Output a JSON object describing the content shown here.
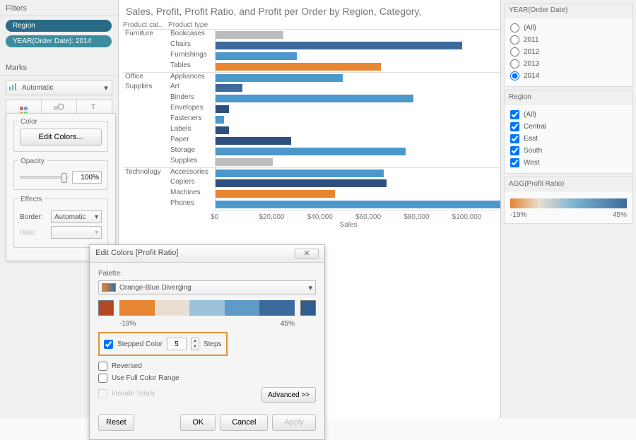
{
  "filters": {
    "title": "Filters",
    "pills": [
      "Region",
      "YEAR(Order Date): 2014"
    ]
  },
  "marks": {
    "title": "Marks",
    "automatic": "Automatic",
    "cells": {
      "color": "Color",
      "size": "Size",
      "label": "Label"
    }
  },
  "color_popup": {
    "color_legend": "Color",
    "edit_colors": "Edit Colors...",
    "opacity_legend": "Opacity",
    "opacity_value": "100%",
    "effects_legend": "Effects",
    "border_label": "Border:",
    "border_value": "Automatic",
    "halo_label": "Halo:"
  },
  "chart": {
    "title": "Sales, Profit, Profit Ratio, and Profit per Order by Region, Category,",
    "hdr_cat": "Product cat..",
    "hdr_type": "Product type",
    "x_axis_title": "Sales",
    "x_ticks": [
      "$0",
      "$20,000",
      "$40,000",
      "$60,000",
      "$80,000",
      "$100,000"
    ]
  },
  "chart_data": {
    "type": "bar",
    "x_axis": "Sales",
    "x_range": [
      0,
      105000
    ],
    "color_encoding": "AGG(Profit Ratio)",
    "color_range_labels": [
      "-19%",
      "45%"
    ],
    "groups": [
      {
        "category": "Furniture",
        "rows": [
          {
            "type": "Bookcases",
            "value": 25000,
            "color": "#bdbdbd"
          },
          {
            "type": "Chairs",
            "value": 91000,
            "color": "#3c6a9c"
          },
          {
            "type": "Furnishings",
            "value": 30000,
            "color": "#4b99cb"
          },
          {
            "type": "Tables",
            "value": 61000,
            "color": "#e78532"
          }
        ]
      },
      {
        "category": "Office Supplies",
        "short": "Office",
        "short2": "Supplies",
        "rows": [
          {
            "type": "Appliances",
            "value": 47000,
            "color": "#4b99cb"
          },
          {
            "type": "Art",
            "value": 10000,
            "color": "#3c6a9c"
          },
          {
            "type": "Binders",
            "value": 73000,
            "color": "#4b99cb"
          },
          {
            "type": "Envelopes",
            "value": 5000,
            "color": "#2f4f7f"
          },
          {
            "type": "Fasteners",
            "value": 3000,
            "color": "#4b99cb"
          },
          {
            "type": "Labels",
            "value": 5000,
            "color": "#2f4f7f"
          },
          {
            "type": "Paper",
            "value": 28000,
            "color": "#2f4f7f"
          },
          {
            "type": "Storage",
            "value": 70000,
            "color": "#4b99cb"
          },
          {
            "type": "Supplies",
            "value": 21000,
            "color": "#bdbdbd"
          }
        ]
      },
      {
        "category": "Technology",
        "rows": [
          {
            "type": "Accessories",
            "value": 62000,
            "color": "#4b99cb"
          },
          {
            "type": "Copiers",
            "value": 63000,
            "color": "#2f4f7f"
          },
          {
            "type": "Machines",
            "value": 44000,
            "color": "#e78532"
          },
          {
            "type": "Phones",
            "value": 105000,
            "color": "#4b99cb"
          }
        ]
      }
    ]
  },
  "year_card": {
    "title": "YEAR(Order Date)",
    "options": [
      "(All)",
      "2011",
      "2012",
      "2013",
      "2014"
    ],
    "selected": "2014"
  },
  "region_card": {
    "title": "Region",
    "options": [
      "(All)",
      "Central",
      "East",
      "South",
      "West"
    ]
  },
  "legend_card": {
    "title": "AGG(Profit Ratio)",
    "min": "-19%",
    "max": "45%"
  },
  "dialog": {
    "title": "Edit Colors [Profit Ratio]",
    "palette_label": "Palette:",
    "palette_name": "Orange-Blue Diverging",
    "range_min": "-19%",
    "range_max": "45%",
    "stepped_label": "Stepped Color",
    "stepped_value": "5",
    "steps_label": "Steps",
    "reversed_label": "Reversed",
    "fullrange_label": "Use Full Color Range",
    "include_totals_label": "Include Totals",
    "advanced": "Advanced >>",
    "reset": "Reset",
    "ok": "OK",
    "cancel": "Cancel",
    "apply": "Apply",
    "gradient_colors": [
      "#e78532",
      "#e8dfd2",
      "#9cc3da",
      "#5f9bc6",
      "#3c6a9c"
    ],
    "end_left": "#b34926",
    "end_right": "#2f5d8c"
  }
}
